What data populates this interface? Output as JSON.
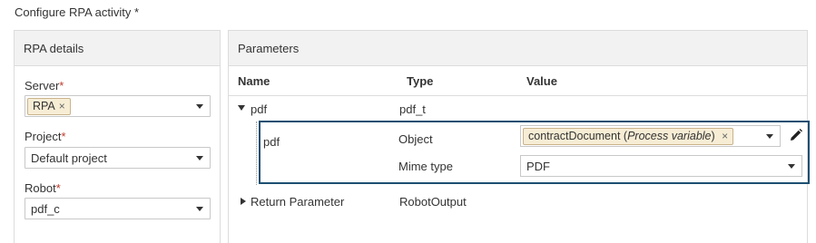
{
  "page": {
    "title": "Configure RPA activity",
    "required_mark": "*"
  },
  "rpa_details": {
    "header": "RPA details",
    "server": {
      "label": "Server",
      "required": "*",
      "tag": "RPA",
      "tag_remove": "×"
    },
    "project": {
      "label": "Project",
      "required": "*",
      "value": "Default project"
    },
    "robot": {
      "label": "Robot",
      "required": "*",
      "value": "pdf_c"
    }
  },
  "parameters": {
    "header": "Parameters",
    "columns": {
      "name": "Name",
      "type": "Type",
      "value": "Value"
    },
    "pdf_row": {
      "name": "pdf",
      "type": "pdf_t"
    },
    "pdf_object": {
      "name": "pdf",
      "object_label": "Object",
      "object_tag_main": "contractDocument",
      "object_tag_open": "(",
      "object_tag_italic": "Process variable",
      "object_tag_close": ")",
      "object_tag_remove": "×",
      "mime_label": "Mime type",
      "mime_value": "PDF"
    },
    "return_row": {
      "name": "Return Parameter",
      "type": "RobotOutput"
    }
  },
  "icons": {
    "caret": "caret-down-icon",
    "edit": "pencil-icon",
    "expand": "triangle-down-icon",
    "collapse": "triangle-right-icon"
  },
  "colors": {
    "highlight_border": "#1d4f72",
    "tag_bg": "#f7edd5",
    "required": "#c0392b"
  }
}
